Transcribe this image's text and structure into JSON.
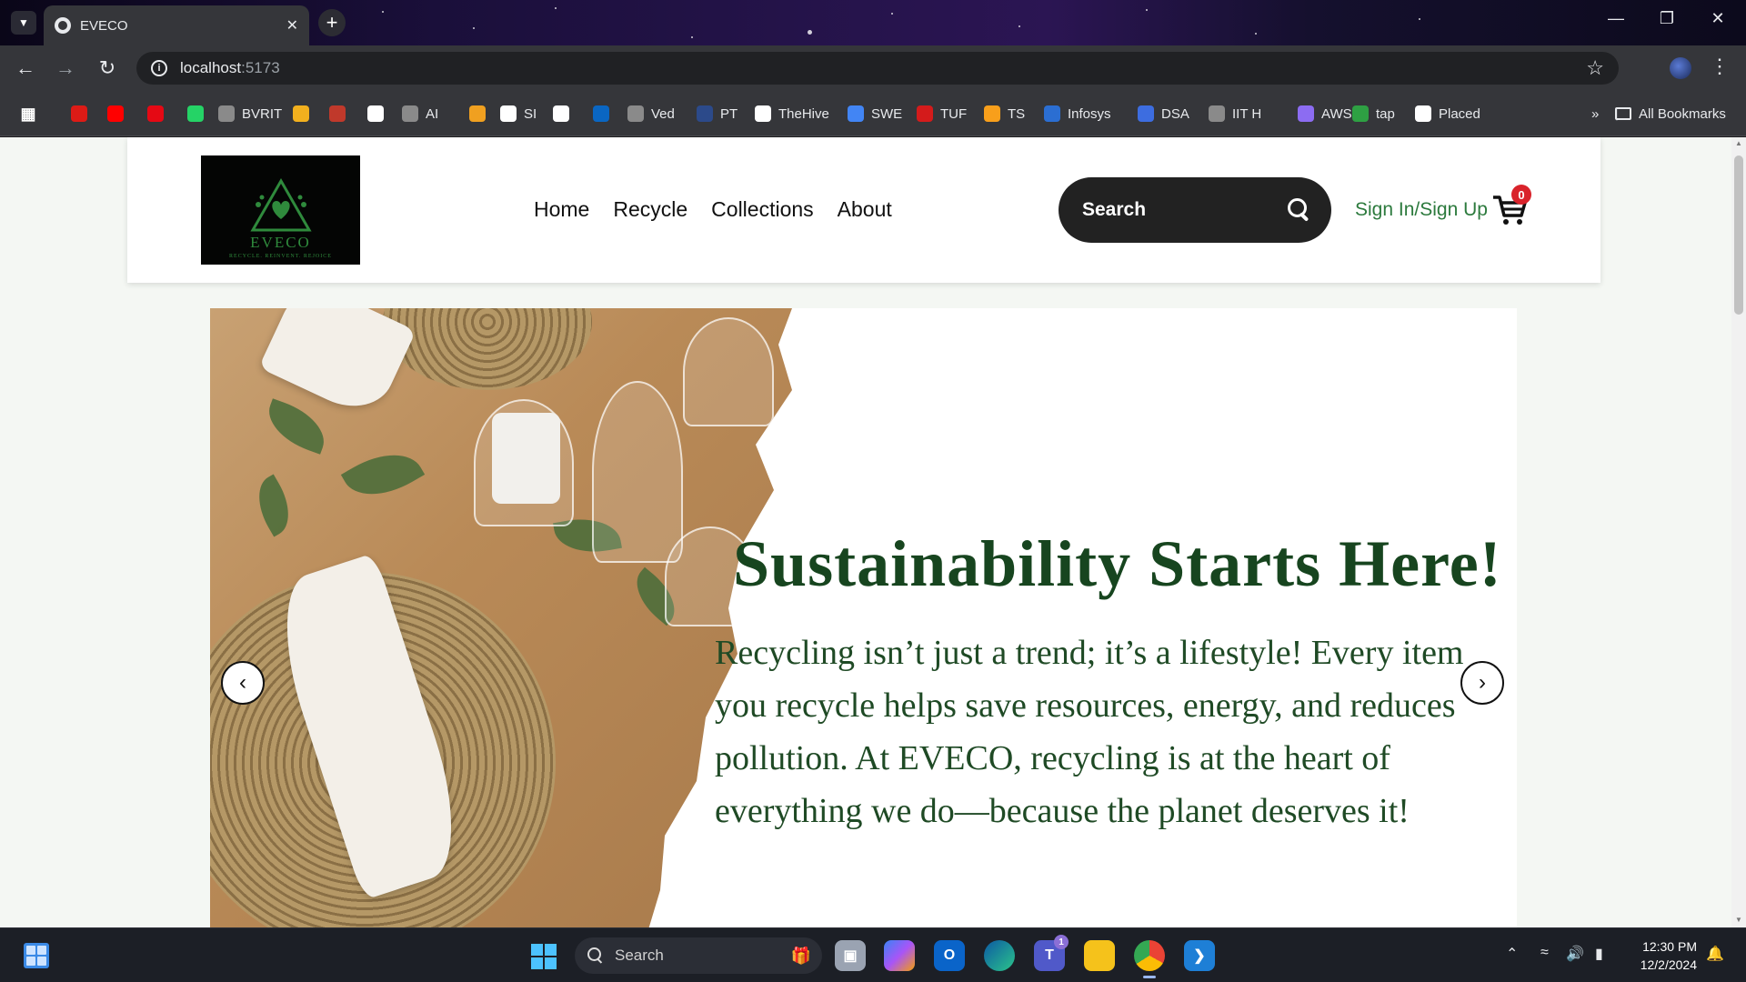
{
  "browser": {
    "tab_title": "EVECO",
    "url_host": "localhost",
    "url_port": ":5173",
    "bookmarks": [
      {
        "label": "",
        "icon": "apps-grid-icon",
        "color": "#35363a"
      },
      {
        "label": "",
        "icon": "angular-icon",
        "color": "#dd1b16"
      },
      {
        "label": "",
        "icon": "youtube-icon",
        "color": "#ff0000"
      },
      {
        "label": "",
        "icon": "netflix-icon",
        "color": "#e50914"
      },
      {
        "label": "",
        "icon": "whatsapp-icon",
        "color": "#25d366"
      },
      {
        "label": "BVRIT",
        "icon": "globe-icon",
        "color": "#8a8a8a"
      },
      {
        "label": "",
        "icon": "image-icon",
        "color": "#f2b01e"
      },
      {
        "label": "",
        "icon": "gift-icon",
        "color": "#c0392b"
      },
      {
        "label": "",
        "icon": "calendar-icon",
        "color": "#ffffff"
      },
      {
        "label": "AI",
        "icon": "openai-icon",
        "color": "#8a8a8a"
      },
      {
        "label": "",
        "icon": "bolt-icon",
        "color": "#f0a020"
      },
      {
        "label": "SI",
        "icon": "doc-icon",
        "color": "#ffffff"
      },
      {
        "label": "",
        "icon": "github-icon",
        "color": "#ffffff"
      },
      {
        "label": "",
        "icon": "linkedin-icon",
        "color": "#0a66c2"
      },
      {
        "label": "Ved",
        "icon": "globe-icon",
        "color": "#8a8a8a"
      },
      {
        "label": "PT",
        "icon": "pt-icon",
        "color": "#2c4a8a"
      },
      {
        "label": "TheHive",
        "icon": "doc-icon",
        "color": "#ffffff"
      },
      {
        "label": "SWE",
        "icon": "docs-icon",
        "color": "#4285f4"
      },
      {
        "label": "TUF",
        "icon": "tuf-icon",
        "color": "#d41b1b"
      },
      {
        "label": "TS",
        "icon": "leetcode-icon",
        "color": "#f89f1b"
      },
      {
        "label": "Infosys",
        "icon": "infosys-icon",
        "color": "#2b6ed2"
      },
      {
        "label": "DSA",
        "icon": "at-icon",
        "color": "#3d6de0"
      },
      {
        "label": "IIT H",
        "icon": "globe-icon",
        "color": "#8a8a8a"
      },
      {
        "label": "AWS",
        "icon": "cube-icon",
        "color": "#8c6cf2"
      },
      {
        "label": "tap",
        "icon": "tap-icon",
        "color": "#2ea043"
      },
      {
        "label": "Placed",
        "icon": "p-icon",
        "color": "#ffffff"
      }
    ],
    "all_bookmarks": "All Bookmarks"
  },
  "site": {
    "logo_text": "EVECO",
    "logo_tagline": "RECYCLE. REINVENT. REJOICE",
    "nav": [
      "Home",
      "Recycle",
      "Collections",
      "About"
    ],
    "search_label": "Search",
    "signin_label": "Sign In/Sign Up",
    "cart_count": "0",
    "hero_title": "Sustainability Starts Here!",
    "hero_body": "Recycling isn’t just a trend; it’s a lifestyle! Every item you recycle helps save resources, energy, and reduces pollution. At EVECO, recycling is at the heart of everything we do—because the planet deserves it!",
    "accent_color": "#17451f"
  },
  "taskbar": {
    "search_label": "Search",
    "time": "12:30 PM",
    "date": "12/2/2024",
    "teams_badge": "1"
  }
}
